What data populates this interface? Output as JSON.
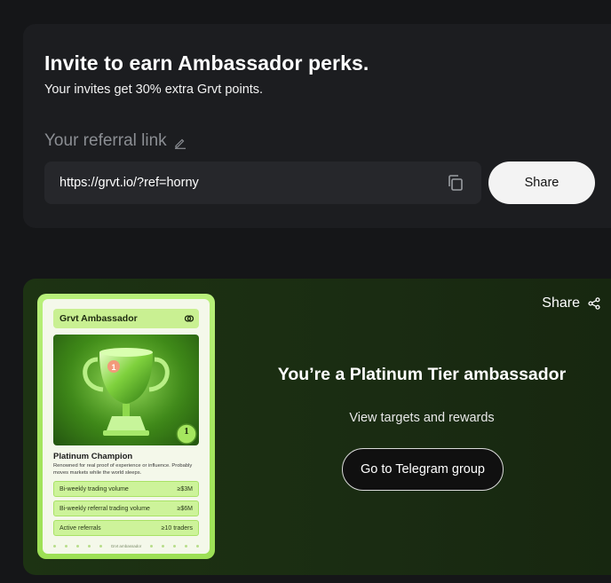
{
  "invite": {
    "title": "Invite to earn Ambassador perks.",
    "subtitle": "Your invites get 30% extra Grvt points.",
    "referral_label": "Your referral link",
    "referral_link": "https://grvt.io/?ref=horny",
    "share_label": "Share",
    "icons": {
      "edit": "pencil-icon",
      "copy": "copy-icon"
    }
  },
  "ambassador": {
    "share_label": "Share",
    "tier_title": "You’re a Platinum Tier ambassador",
    "targets_text": "View targets and rewards",
    "telegram_button": "Go to Telegram group",
    "card": {
      "header": "Grvt Ambassador",
      "name": "Platinum Champion",
      "description": "Renowned for real proof of experience or influence. Probably moves markets while the world sleeps.",
      "badge_number": "1",
      "stats": [
        {
          "label": "Bi-weekly trading volume",
          "value": "≥$3M"
        },
        {
          "label": "Bi-weekly referral trading volume",
          "value": "≥$6M"
        },
        {
          "label": "Active referrals",
          "value": "≥10 traders"
        }
      ],
      "footer": "Grvt ambassador"
    }
  },
  "colors": {
    "page_bg": "#151618",
    "panel_bg": "#1c1d20",
    "accent_green": "#a5e65f",
    "ambassador_bg": "#1d3313"
  }
}
